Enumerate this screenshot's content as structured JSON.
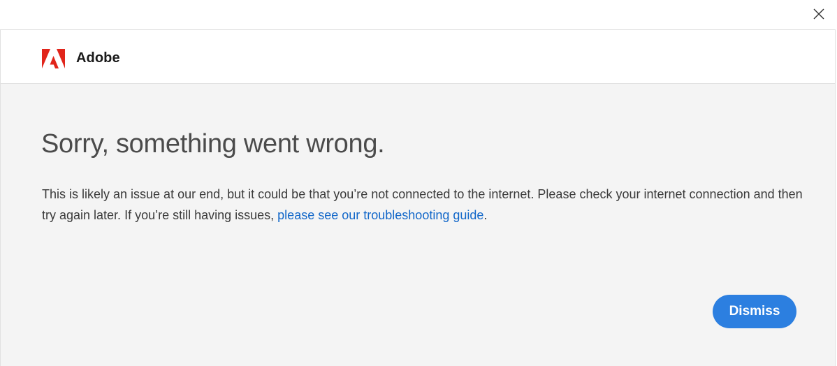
{
  "window": {
    "close_icon": "close-icon"
  },
  "brand": {
    "logo_icon": "adobe-logo-icon",
    "name": "Adobe",
    "logo_color": "#e1251b"
  },
  "error": {
    "title": "Sorry, something went wrong.",
    "body_text": "This is likely an issue at our end, but it could be that you’re not connected to the internet. Please check your internet connection and then try again later. If you’re still having issues, ",
    "link_text": "please see our troubleshooting guide",
    "body_end": ".",
    "link_color": "#1267c9"
  },
  "actions": {
    "dismiss_label": "Dismiss",
    "dismiss_color": "#2c7fe0"
  }
}
